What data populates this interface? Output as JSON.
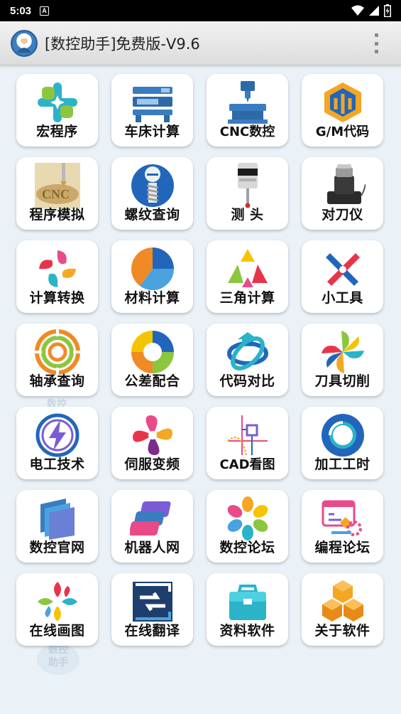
{
  "status_bar": {
    "time": "5:03",
    "notification_icon": "A"
  },
  "app_bar": {
    "title": "[数控助手]免费版-V9.6"
  },
  "watermark": {
    "text": "数控\n助手"
  },
  "tiles": [
    {
      "label": "宏程序",
      "icon": "macro-icon"
    },
    {
      "label": "车床计算",
      "icon": "lathe-icon"
    },
    {
      "label": "CNC数控",
      "icon": "cnc-machine-icon"
    },
    {
      "label": "G/M代码",
      "icon": "gm-code-icon"
    },
    {
      "label": "程序模拟",
      "icon": "program-simulation-icon"
    },
    {
      "label": "螺纹查询",
      "icon": "thread-icon"
    },
    {
      "label": "测 头",
      "icon": "probe-icon"
    },
    {
      "label": "对刀仪",
      "icon": "tool-setter-icon"
    },
    {
      "label": "计算转换",
      "icon": "conversion-icon"
    },
    {
      "label": "材料计算",
      "icon": "material-pie-icon"
    },
    {
      "label": "三角计算",
      "icon": "triangle-icon"
    },
    {
      "label": "小工具",
      "icon": "tools-icon"
    },
    {
      "label": "轴承查询",
      "icon": "bearing-icon"
    },
    {
      "label": "公差配合",
      "icon": "tolerance-icon"
    },
    {
      "label": "代码对比",
      "icon": "compare-icon"
    },
    {
      "label": "刀具切削",
      "icon": "cutter-icon"
    },
    {
      "label": "电工技术",
      "icon": "electric-icon"
    },
    {
      "label": "伺服变频",
      "icon": "servo-icon"
    },
    {
      "label": "CAD看图",
      "icon": "cad-icon"
    },
    {
      "label": "加工工时",
      "icon": "work-hours-icon"
    },
    {
      "label": "数控官网",
      "icon": "official-site-icon"
    },
    {
      "label": "机器人网",
      "icon": "robot-icon"
    },
    {
      "label": "数控论坛",
      "icon": "forum-icon"
    },
    {
      "label": "编程论坛",
      "icon": "programming-forum-icon"
    },
    {
      "label": "在线画图",
      "icon": "online-draw-icon"
    },
    {
      "label": "在线翻译",
      "icon": "translate-icon"
    },
    {
      "label": "资料软件",
      "icon": "toolbox-icon"
    },
    {
      "label": "关于软件",
      "icon": "about-icon"
    }
  ]
}
